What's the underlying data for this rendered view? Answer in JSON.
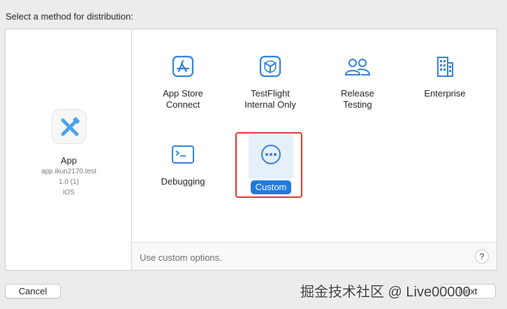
{
  "dialog": {
    "prompt": "Select a method for distribution:"
  },
  "app": {
    "name": "App",
    "bundle_id": "app.ikun2170.test",
    "version": "1.0 (1)",
    "platform": "iOS"
  },
  "options": [
    {
      "label": "App Store\nConnect",
      "icon": "app-store-icon"
    },
    {
      "label": "TestFlight\nInternal Only",
      "icon": "testflight-icon"
    },
    {
      "label": "Release\nTesting",
      "icon": "people-icon"
    },
    {
      "label": "Enterprise",
      "icon": "building-icon"
    },
    {
      "label": "Debugging",
      "icon": "terminal-icon"
    },
    {
      "label": "Custom",
      "icon": "ellipsis-circle-icon",
      "selected": true
    }
  ],
  "status": {
    "description": "Use custom options.",
    "help_label": "?"
  },
  "buttons": {
    "cancel": "Cancel",
    "next": "Next"
  },
  "watermark": "掘金技术社区 @ Live00000",
  "colors": {
    "accent": "#1f7ae0",
    "icon_blue": "#2f7fd6",
    "highlight_border": "#e0302b",
    "selection_bg": "#e6f0fb"
  }
}
